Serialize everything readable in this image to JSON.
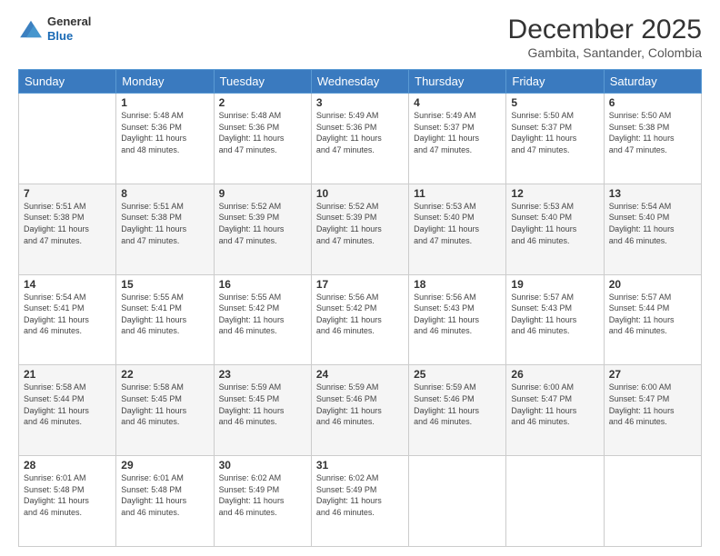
{
  "header": {
    "logo": {
      "general": "General",
      "blue": "Blue"
    },
    "title": "December 2025",
    "subtitle": "Gambita, Santander, Colombia"
  },
  "weekdays": [
    "Sunday",
    "Monday",
    "Tuesday",
    "Wednesday",
    "Thursday",
    "Friday",
    "Saturday"
  ],
  "weeks": [
    [
      {
        "day": "",
        "info": ""
      },
      {
        "day": "1",
        "info": "Sunrise: 5:48 AM\nSunset: 5:36 PM\nDaylight: 11 hours\nand 48 minutes."
      },
      {
        "day": "2",
        "info": "Sunrise: 5:48 AM\nSunset: 5:36 PM\nDaylight: 11 hours\nand 47 minutes."
      },
      {
        "day": "3",
        "info": "Sunrise: 5:49 AM\nSunset: 5:36 PM\nDaylight: 11 hours\nand 47 minutes."
      },
      {
        "day": "4",
        "info": "Sunrise: 5:49 AM\nSunset: 5:37 PM\nDaylight: 11 hours\nand 47 minutes."
      },
      {
        "day": "5",
        "info": "Sunrise: 5:50 AM\nSunset: 5:37 PM\nDaylight: 11 hours\nand 47 minutes."
      },
      {
        "day": "6",
        "info": "Sunrise: 5:50 AM\nSunset: 5:38 PM\nDaylight: 11 hours\nand 47 minutes."
      }
    ],
    [
      {
        "day": "7",
        "info": "Sunrise: 5:51 AM\nSunset: 5:38 PM\nDaylight: 11 hours\nand 47 minutes."
      },
      {
        "day": "8",
        "info": "Sunrise: 5:51 AM\nSunset: 5:38 PM\nDaylight: 11 hours\nand 47 minutes."
      },
      {
        "day": "9",
        "info": "Sunrise: 5:52 AM\nSunset: 5:39 PM\nDaylight: 11 hours\nand 47 minutes."
      },
      {
        "day": "10",
        "info": "Sunrise: 5:52 AM\nSunset: 5:39 PM\nDaylight: 11 hours\nand 47 minutes."
      },
      {
        "day": "11",
        "info": "Sunrise: 5:53 AM\nSunset: 5:40 PM\nDaylight: 11 hours\nand 47 minutes."
      },
      {
        "day": "12",
        "info": "Sunrise: 5:53 AM\nSunset: 5:40 PM\nDaylight: 11 hours\nand 46 minutes."
      },
      {
        "day": "13",
        "info": "Sunrise: 5:54 AM\nSunset: 5:40 PM\nDaylight: 11 hours\nand 46 minutes."
      }
    ],
    [
      {
        "day": "14",
        "info": "Sunrise: 5:54 AM\nSunset: 5:41 PM\nDaylight: 11 hours\nand 46 minutes."
      },
      {
        "day": "15",
        "info": "Sunrise: 5:55 AM\nSunset: 5:41 PM\nDaylight: 11 hours\nand 46 minutes."
      },
      {
        "day": "16",
        "info": "Sunrise: 5:55 AM\nSunset: 5:42 PM\nDaylight: 11 hours\nand 46 minutes."
      },
      {
        "day": "17",
        "info": "Sunrise: 5:56 AM\nSunset: 5:42 PM\nDaylight: 11 hours\nand 46 minutes."
      },
      {
        "day": "18",
        "info": "Sunrise: 5:56 AM\nSunset: 5:43 PM\nDaylight: 11 hours\nand 46 minutes."
      },
      {
        "day": "19",
        "info": "Sunrise: 5:57 AM\nSunset: 5:43 PM\nDaylight: 11 hours\nand 46 minutes."
      },
      {
        "day": "20",
        "info": "Sunrise: 5:57 AM\nSunset: 5:44 PM\nDaylight: 11 hours\nand 46 minutes."
      }
    ],
    [
      {
        "day": "21",
        "info": "Sunrise: 5:58 AM\nSunset: 5:44 PM\nDaylight: 11 hours\nand 46 minutes."
      },
      {
        "day": "22",
        "info": "Sunrise: 5:58 AM\nSunset: 5:45 PM\nDaylight: 11 hours\nand 46 minutes."
      },
      {
        "day": "23",
        "info": "Sunrise: 5:59 AM\nSunset: 5:45 PM\nDaylight: 11 hours\nand 46 minutes."
      },
      {
        "day": "24",
        "info": "Sunrise: 5:59 AM\nSunset: 5:46 PM\nDaylight: 11 hours\nand 46 minutes."
      },
      {
        "day": "25",
        "info": "Sunrise: 5:59 AM\nSunset: 5:46 PM\nDaylight: 11 hours\nand 46 minutes."
      },
      {
        "day": "26",
        "info": "Sunrise: 6:00 AM\nSunset: 5:47 PM\nDaylight: 11 hours\nand 46 minutes."
      },
      {
        "day": "27",
        "info": "Sunrise: 6:00 AM\nSunset: 5:47 PM\nDaylight: 11 hours\nand 46 minutes."
      }
    ],
    [
      {
        "day": "28",
        "info": "Sunrise: 6:01 AM\nSunset: 5:48 PM\nDaylight: 11 hours\nand 46 minutes."
      },
      {
        "day": "29",
        "info": "Sunrise: 6:01 AM\nSunset: 5:48 PM\nDaylight: 11 hours\nand 46 minutes."
      },
      {
        "day": "30",
        "info": "Sunrise: 6:02 AM\nSunset: 5:49 PM\nDaylight: 11 hours\nand 46 minutes."
      },
      {
        "day": "31",
        "info": "Sunrise: 6:02 AM\nSunset: 5:49 PM\nDaylight: 11 hours\nand 46 minutes."
      },
      {
        "day": "",
        "info": ""
      },
      {
        "day": "",
        "info": ""
      },
      {
        "day": "",
        "info": ""
      }
    ]
  ]
}
